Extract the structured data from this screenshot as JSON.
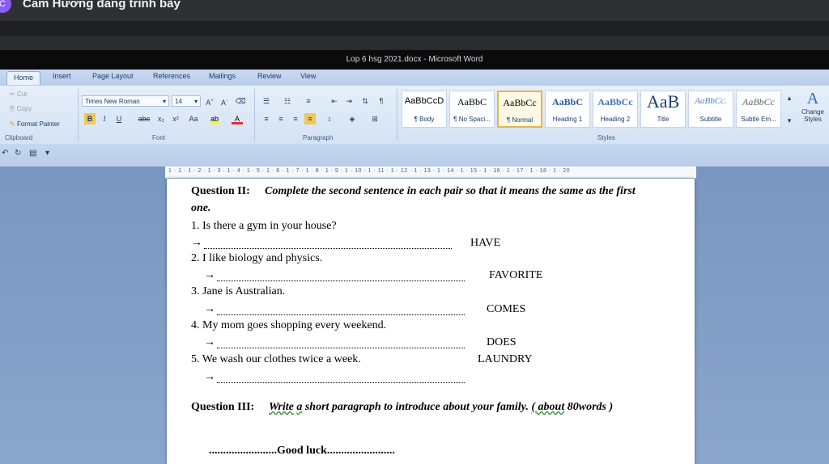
{
  "presenter": {
    "badge": "C",
    "text": "Cam Hương đang trình bày"
  },
  "window": {
    "title": "Lop 6 hsg 2021.docx - Microsoft Word"
  },
  "tabs": [
    "Home",
    "Insert",
    "Page Layout",
    "References",
    "Mailings",
    "Review",
    "View"
  ],
  "clipboard": {
    "cut": "Cut",
    "copy": "Copy",
    "format_painter": "Format Painter",
    "label": "Clipboard"
  },
  "font": {
    "name": "Times New Roman",
    "size": "14",
    "label": "Font"
  },
  "paragraph": {
    "label": "Paragraph"
  },
  "styles": {
    "label": "Styles",
    "items": [
      {
        "preview": "AaBbCcD",
        "name": "¶ Body"
      },
      {
        "preview": "AaBbC",
        "name": "¶ No Spaci..."
      },
      {
        "preview": "AaBbCc",
        "name": "¶ Normal"
      },
      {
        "preview": "AaBbC",
        "name": "Heading 1"
      },
      {
        "preview": "AaBbCc",
        "name": "Heading 2"
      },
      {
        "preview": "AaB",
        "name": "Title"
      },
      {
        "preview": "AaBbCc.",
        "name": "Subtitle"
      },
      {
        "preview": "AaBbCc",
        "name": "Subtle Em..."
      }
    ],
    "change": "Change Styles"
  },
  "ruler_text": "1 · 1 · 1 · 2 · 1 · 3 · 1 · 4 · 1 · 5 · 1 · 6 · 1 · 7 · 1 · 8 · 1 · 9 · 1 · 10 · 1 · 11 · 1 · 12 · 1 · 13 · 1 · 14 · 1 · 15 · 1 · 16 · 1 · 17 · 1 · 18 · 1 · 20",
  "doc": {
    "q2_label": "Question II:",
    "q2_text": "Complete the second sentence in each pair so that it means the same as the first",
    "q2_text2": "one.",
    "items": [
      {
        "sentence": "1. Is there a gym in your house?",
        "keyword": "HAVE"
      },
      {
        "sentence": "2. I like biology and physics.",
        "keyword": "FAVORITE"
      },
      {
        "sentence": "3. Jane is Australian.",
        "keyword": "COMES"
      },
      {
        "sentence": "4. My mom goes shopping every weekend.",
        "keyword": "DOES"
      },
      {
        "sentence": "5. We wash our clothes twice a week.",
        "keyword": "LAUNDRY"
      }
    ],
    "arrow": "→",
    "q3_label": "Question III:",
    "q3_write": "Write",
    "q3_a": "a",
    "q3_rest": "short paragraph to introduce  about your family.",
    "q3_about": "( about",
    "q3_words": "80words )",
    "good_luck": "........................Good luck........................"
  }
}
